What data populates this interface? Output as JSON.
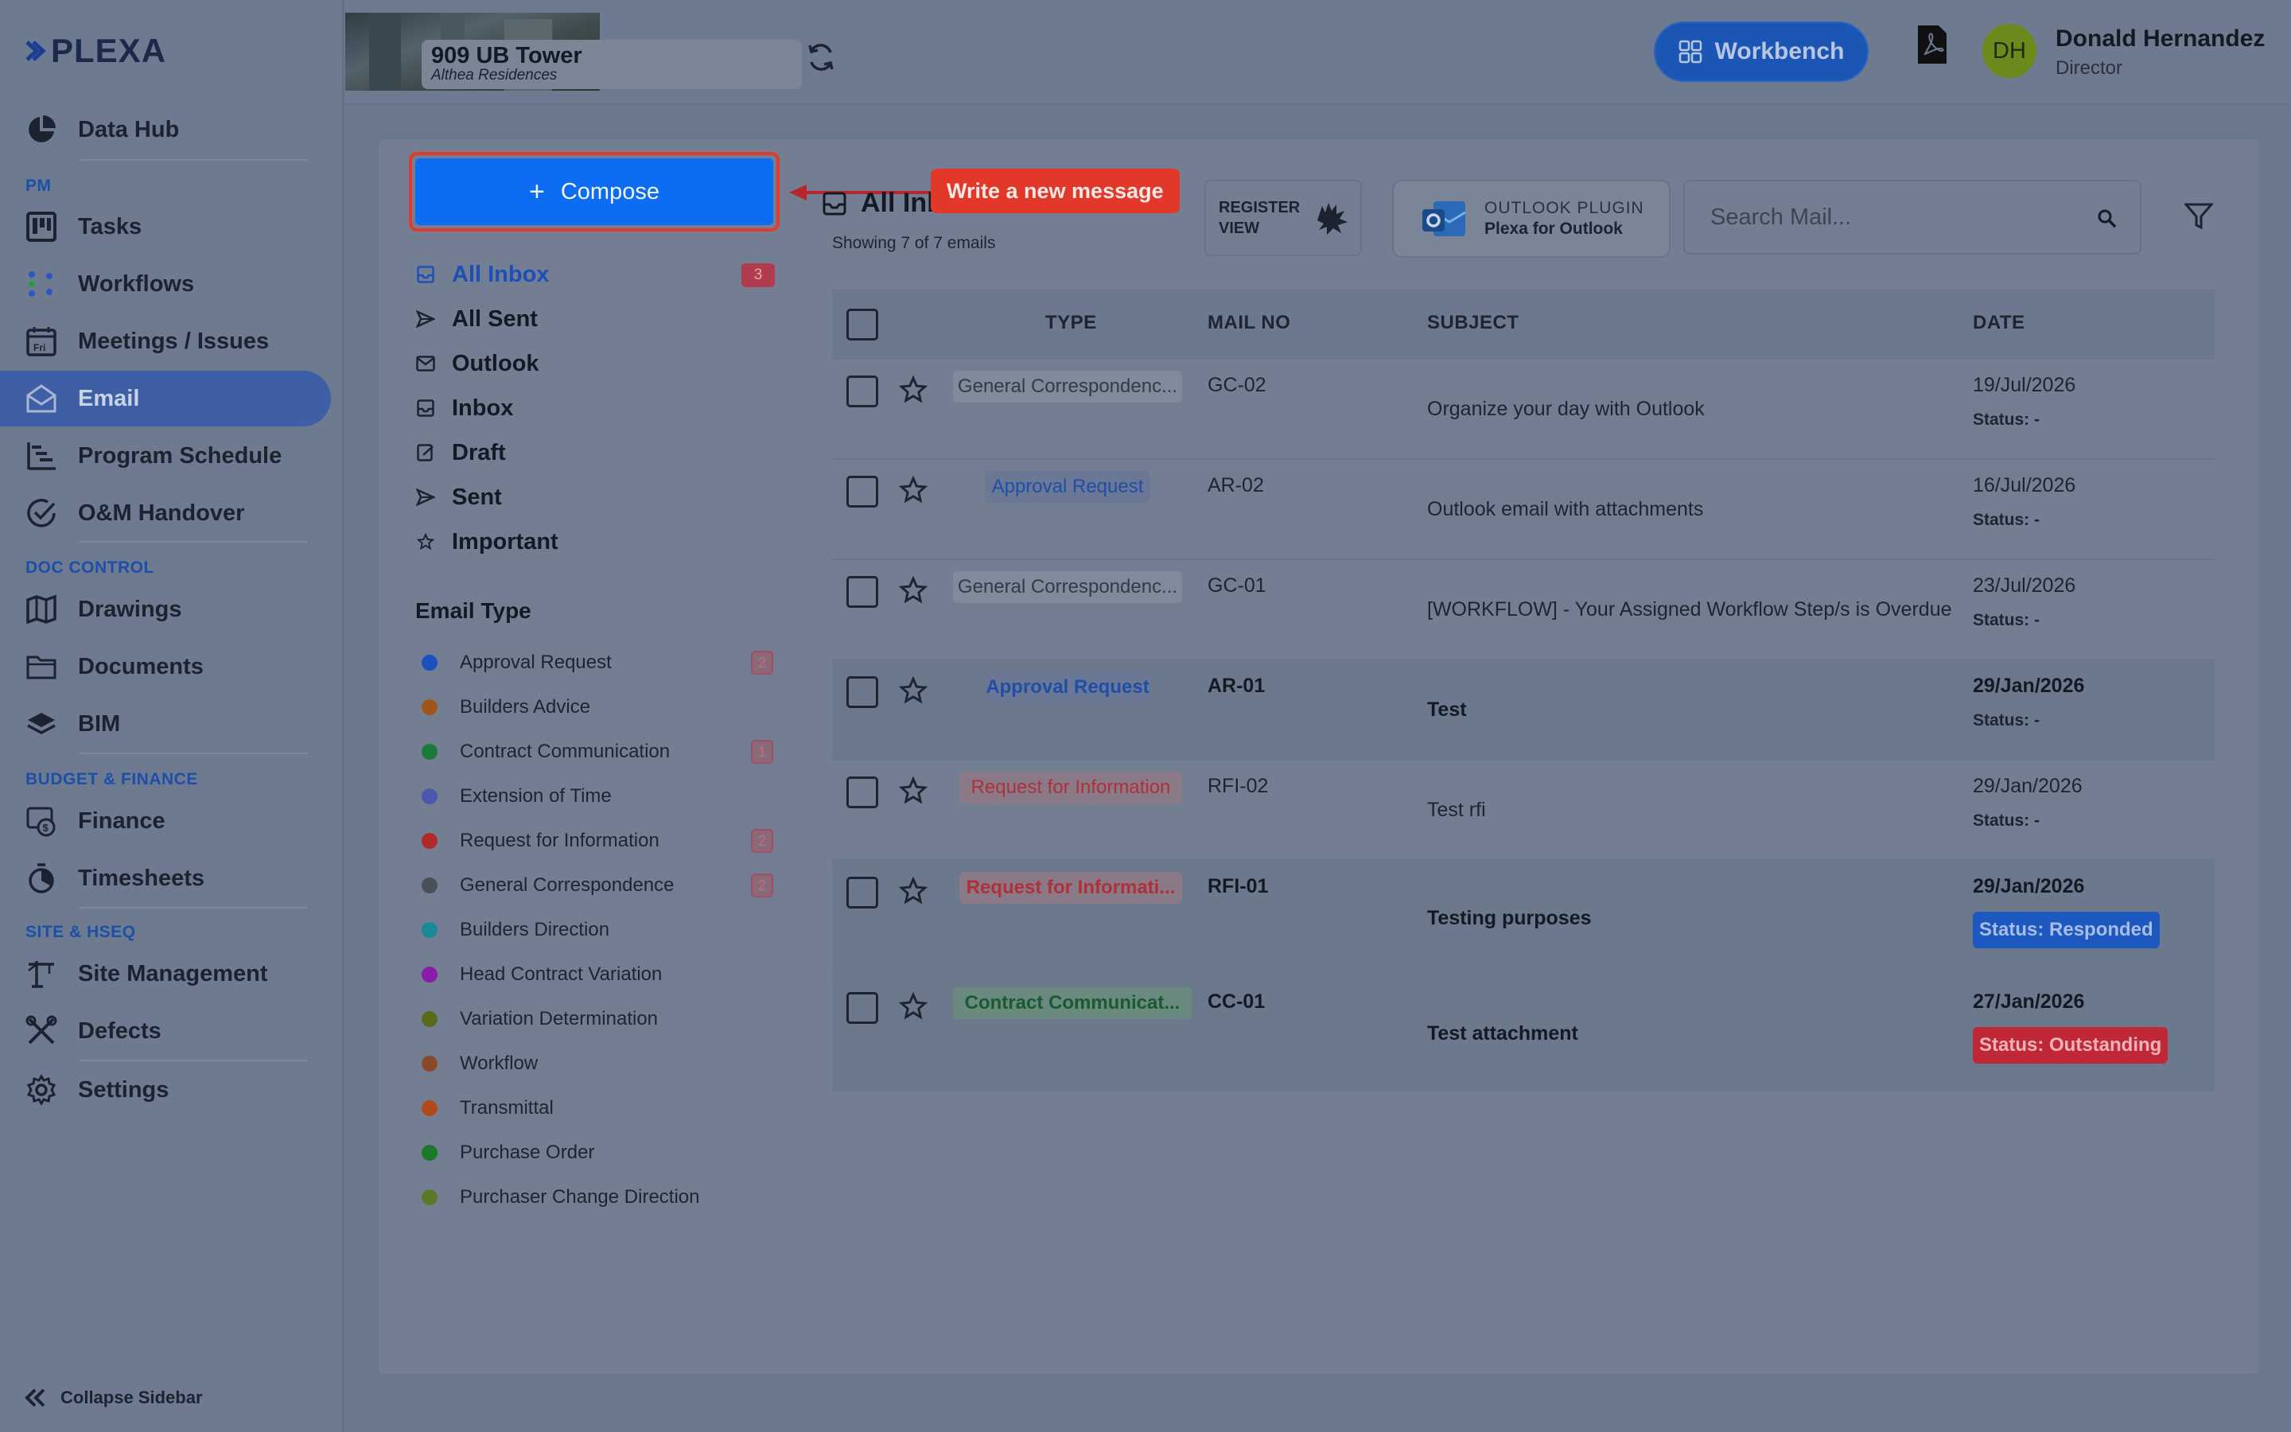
{
  "app": {
    "logo": "PLEXA",
    "logo_mark": "✖"
  },
  "sidebar": {
    "items": [
      {
        "label": "Data Hub",
        "icon": "pie-chart-icon"
      },
      {
        "label": "Tasks",
        "icon": "kanban-icon"
      },
      {
        "label": "Workflows",
        "icon": "workflow-icon"
      },
      {
        "label": "Meetings / Issues",
        "icon": "calendar-icon"
      },
      {
        "label": "Email",
        "icon": "envelope-icon",
        "active": true
      },
      {
        "label": "Program Schedule",
        "icon": "gantt-icon"
      },
      {
        "label": "O&M Handover",
        "icon": "check-circle-icon"
      },
      {
        "label": "Drawings",
        "icon": "map-icon"
      },
      {
        "label": "Documents",
        "icon": "folder-icon"
      },
      {
        "label": "BIM",
        "icon": "layers-icon"
      },
      {
        "label": "Finance",
        "icon": "finance-icon"
      },
      {
        "label": "Timesheets",
        "icon": "stopwatch-icon"
      },
      {
        "label": "Site Management",
        "icon": "crane-icon"
      },
      {
        "label": "Defects",
        "icon": "tools-icon"
      },
      {
        "label": "Settings",
        "icon": "gear-icon"
      }
    ],
    "sections": {
      "pm": "PM",
      "doc": "DOC CONTROL",
      "budget": "BUDGET & FINANCE",
      "site": "SITE & HSEQ"
    },
    "collapse_label": "Collapse Sidebar"
  },
  "header": {
    "project_title": "909 UB Tower",
    "project_subtitle": "Althea Residences",
    "workbench_label": "Workbench",
    "user_initials": "DH",
    "user_name": "Donald Hernandez",
    "user_role": "Director"
  },
  "compose": {
    "label": "Compose",
    "tooltip": "Write a new message"
  },
  "folders": [
    {
      "label": "All Inbox",
      "count": "3",
      "active": true
    },
    {
      "label": "All Sent"
    },
    {
      "label": "Outlook"
    },
    {
      "label": "Inbox"
    },
    {
      "label": "Draft"
    },
    {
      "label": "Sent"
    },
    {
      "label": "Important"
    }
  ],
  "email_types": {
    "title": "Email Type",
    "items": [
      {
        "label": "Approval Request",
        "color": "#1a4fc0",
        "count": "2"
      },
      {
        "label": "Builders Advice",
        "color": "#a0561a"
      },
      {
        "label": "Contract Communication",
        "color": "#1a7a3a",
        "count": "1"
      },
      {
        "label": "Extension of Time",
        "color": "#4a58b0"
      },
      {
        "label": "Request for Information",
        "color": "#b02a2a",
        "count": "2"
      },
      {
        "label": "General Correspondence",
        "color": "#4a5058",
        "count": "2"
      },
      {
        "label": "Builders Direction",
        "color": "#1a8a9a"
      },
      {
        "label": "Head Contract Variation",
        "color": "#8a1aa8"
      },
      {
        "label": "Variation Determination",
        "color": "#5a6a1a"
      },
      {
        "label": "Workflow",
        "color": "#8a4a2a"
      },
      {
        "label": "Transmittal",
        "color": "#b04a1a"
      },
      {
        "label": "Purchase Order",
        "color": "#1a7a2a"
      },
      {
        "label": "Purchaser Change Direction",
        "color": "#5a7a2a"
      }
    ]
  },
  "list": {
    "title": "All Inbox",
    "showing": "Showing 7 of 7 emails",
    "register_view": [
      "REGISTER",
      "VIEW"
    ],
    "plugin_title": "OUTLOOK PLUGIN",
    "plugin_subtitle": "Plexa for Outlook",
    "search_placeholder": "Search Mail...",
    "columns": {
      "type": "TYPE",
      "mail_no": "MAIL NO",
      "subject": "SUBJECT",
      "date": "DATE"
    },
    "rows": [
      {
        "type": "General Correspondenc...",
        "type_kind": "gc",
        "mail_no": "GC-02",
        "subject": "Organize your day with Outlook",
        "date": "19/Jul/2026",
        "status": "Status: -"
      },
      {
        "type": "Approval Request",
        "type_kind": "ar",
        "mail_no": "AR-02",
        "subject": "Outlook email with attachments",
        "date": "16/Jul/2026",
        "status": "Status: -"
      },
      {
        "type": "General Correspondenc...",
        "type_kind": "gc",
        "mail_no": "GC-01",
        "subject": "[WORKFLOW] - Your Assigned Workflow Step/s is Overdue",
        "date": "23/Jul/2026",
        "status": "Status: -"
      },
      {
        "type": "Approval Request",
        "type_kind": "ar",
        "mail_no": "AR-01",
        "subject": "Test",
        "date": "29/Jan/2026",
        "status": "Status: -",
        "unread": true
      },
      {
        "type": "Request for Information",
        "type_kind": "rfi",
        "mail_no": "RFI-02",
        "subject": "Test rfi",
        "date": "29/Jan/2026",
        "status": "Status: -"
      },
      {
        "type": "Request for Informati...",
        "type_kind": "rfi",
        "mail_no": "RFI-01",
        "subject": "Testing purposes",
        "date": "29/Jan/2026",
        "status": "Status: Responded",
        "unread": true
      },
      {
        "type": "Contract Communicat...",
        "type_kind": "cc",
        "mail_no": "CC-01",
        "subject": "Test attachment",
        "date": "27/Jan/2026",
        "status": "Status: Outstanding",
        "unread": true
      }
    ]
  }
}
